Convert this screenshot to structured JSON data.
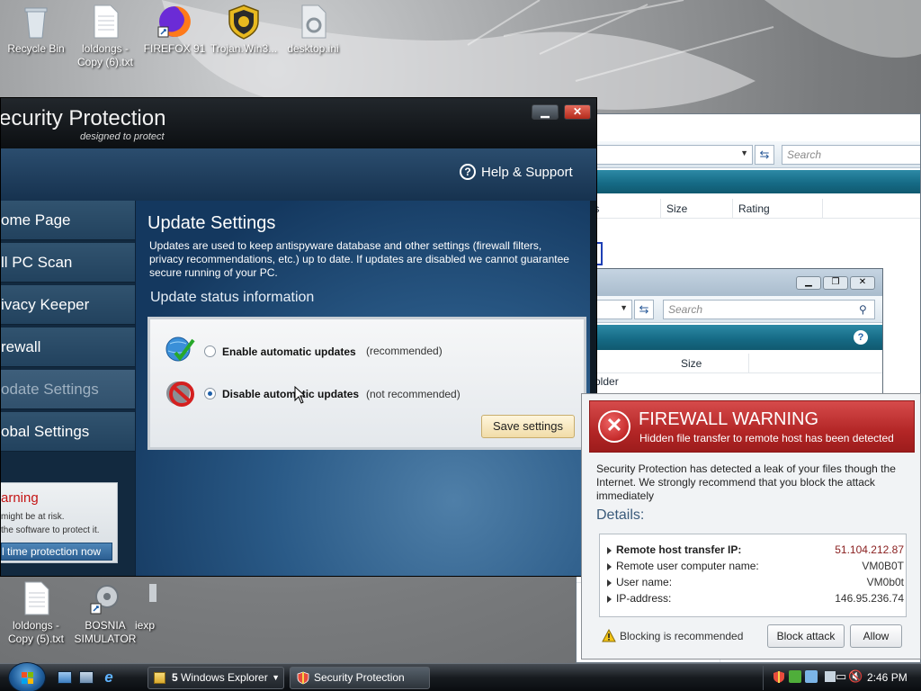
{
  "desktop": {
    "icons": [
      {
        "label": "Recycle Bin"
      },
      {
        "label": "loldongs - Copy (6).txt"
      },
      {
        "label": "FIREFOX 91"
      },
      {
        "label": "Trojan.Win3..."
      },
      {
        "label": "desktop.ini"
      },
      {
        "label": "loldongs - Copy (5).txt"
      },
      {
        "label": "BOSNIA SIMULATOR"
      },
      {
        "label": "iexp"
      }
    ]
  },
  "explorer_back": {
    "search_placeholder": "Search",
    "columns": [
      "ags",
      "Size",
      "Rating"
    ]
  },
  "explorer_front": {
    "search_placeholder": "Search",
    "columns": [
      "Size"
    ],
    "row_text": "older"
  },
  "security": {
    "title": "ecurity Protection",
    "subtitle": "designed to protect",
    "help_label": "Help & Support",
    "nav": [
      {
        "label": "ome Page"
      },
      {
        "label": "ll PC Scan"
      },
      {
        "label": "ivacy Keeper"
      },
      {
        "label": "rewall"
      },
      {
        "label": "odate Settings"
      },
      {
        "label": "obal Settings"
      }
    ],
    "warning": {
      "title": "arning",
      "line1": "might be at risk.",
      "line2": "the software to protect it.",
      "button": "l time protection now"
    },
    "content": {
      "heading": "Update Settings",
      "description": "Updates are used to keep antispyware database and other settings (firewall filters, privacy recommendations, etc.) up to date. If updates are disabled we cannot guarantee secure running of your PC.",
      "status_heading": "Update status information",
      "option_enable": "Enable automatic updates",
      "option_enable_note": "(recommended)",
      "option_disable": "Disable automatic updates",
      "option_disable_note": "(not recommended)",
      "save_label": "Save settings",
      "selected_option": "disable"
    }
  },
  "firewall": {
    "title": "FIREWALL WARNING",
    "subtitle": "Hidden file transfer to remote host has been detected",
    "message": "Security Protection has detected a leak of your files though the Internet. We strongly recommend that you block the attack immediately",
    "details_heading": "Details:",
    "details": [
      {
        "label": "Remote host transfer IP:",
        "value": "51.104.212.87"
      },
      {
        "label": "Remote user computer name:",
        "value": "VM0B0T"
      },
      {
        "label": "User name:",
        "value": "VM0b0t"
      },
      {
        "label": "IP-address:",
        "value": "146.95.236.74"
      }
    ],
    "blocking_note": "Blocking is recommended",
    "block_label": "Block attack",
    "allow_label": "Allow"
  },
  "taskbar": {
    "explorer_count": "5",
    "explorer_label": "Windows Explorer",
    "security_label": "Security Protection",
    "clock": "2:46 PM"
  },
  "colors": {
    "firewall_red": "#b32626",
    "nav_active_text": "#9fb1c1",
    "accent_blue": "#1e5fa8"
  }
}
